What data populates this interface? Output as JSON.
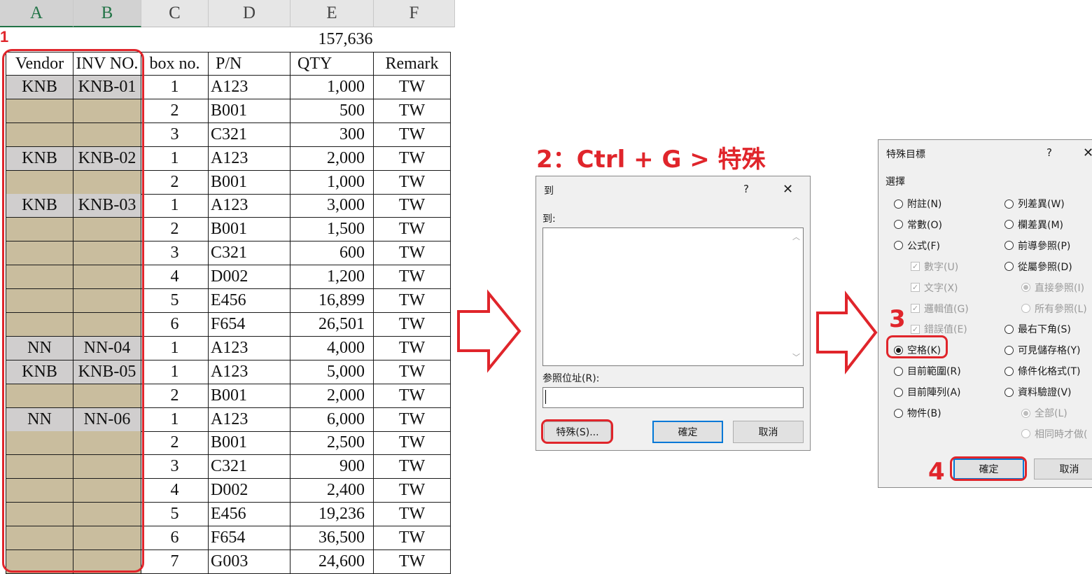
{
  "sheet": {
    "columns": [
      "A",
      "B",
      "C",
      "D",
      "E",
      "F"
    ],
    "row1_marker": "1",
    "total": "157,636",
    "headers": [
      "Vendor",
      "INV NO.",
      "box no.",
      "P/N",
      "QTY",
      "Remark"
    ],
    "rows": [
      {
        "vendor": "KNB",
        "inv": "KNB-01",
        "box": "1",
        "pn": "A123",
        "qty": "1,000",
        "remark": "TW"
      },
      {
        "vendor": "",
        "inv": "",
        "box": "2",
        "pn": "B001",
        "qty": "500",
        "remark": "TW"
      },
      {
        "vendor": "",
        "inv": "",
        "box": "3",
        "pn": "C321",
        "qty": "300",
        "remark": "TW"
      },
      {
        "vendor": "KNB",
        "inv": "KNB-02",
        "box": "1",
        "pn": "A123",
        "qty": "2,000",
        "remark": "TW"
      },
      {
        "vendor": "",
        "inv": "",
        "box": "2",
        "pn": "B001",
        "qty": "1,000",
        "remark": "TW"
      },
      {
        "vendor": "KNB",
        "inv": "KNB-03",
        "box": "1",
        "pn": "A123",
        "qty": "3,000",
        "remark": "TW"
      },
      {
        "vendor": "",
        "inv": "",
        "box": "2",
        "pn": "B001",
        "qty": "1,500",
        "remark": "TW"
      },
      {
        "vendor": "",
        "inv": "",
        "box": "3",
        "pn": "C321",
        "qty": "600",
        "remark": "TW"
      },
      {
        "vendor": "",
        "inv": "",
        "box": "4",
        "pn": "D002",
        "qty": "1,200",
        "remark": "TW"
      },
      {
        "vendor": "",
        "inv": "",
        "box": "5",
        "pn": "E456",
        "qty": "16,899",
        "remark": "TW"
      },
      {
        "vendor": "",
        "inv": "",
        "box": "6",
        "pn": "F654",
        "qty": "26,501",
        "remark": "TW"
      },
      {
        "vendor": "NN",
        "inv": "NN-04",
        "box": "1",
        "pn": "A123",
        "qty": "4,000",
        "remark": "TW"
      },
      {
        "vendor": "KNB",
        "inv": "KNB-05",
        "box": "1",
        "pn": "A123",
        "qty": "5,000",
        "remark": "TW"
      },
      {
        "vendor": "",
        "inv": "",
        "box": "2",
        "pn": "B001",
        "qty": "2,000",
        "remark": "TW"
      },
      {
        "vendor": "NN",
        "inv": "NN-06",
        "box": "1",
        "pn": "A123",
        "qty": "6,000",
        "remark": "TW"
      },
      {
        "vendor": "",
        "inv": "",
        "box": "2",
        "pn": "B001",
        "qty": "2,500",
        "remark": "TW"
      },
      {
        "vendor": "",
        "inv": "",
        "box": "3",
        "pn": "C321",
        "qty": "900",
        "remark": "TW"
      },
      {
        "vendor": "",
        "inv": "",
        "box": "4",
        "pn": "D002",
        "qty": "2,400",
        "remark": "TW"
      },
      {
        "vendor": "",
        "inv": "",
        "box": "5",
        "pn": "E456",
        "qty": "19,236",
        "remark": "TW"
      },
      {
        "vendor": "",
        "inv": "",
        "box": "6",
        "pn": "F654",
        "qty": "36,500",
        "remark": "TW"
      },
      {
        "vendor": "",
        "inv": "",
        "box": "7",
        "pn": "G003",
        "qty": "24,600",
        "remark": "TW"
      }
    ],
    "colors": {
      "filled": "#d0cece",
      "blank": "#c9bd9e",
      "annotation": "#e0252b"
    }
  },
  "step2": {
    "label": "2：Ctrl + G > 特殊"
  },
  "goto_dialog": {
    "title": "到",
    "help": "?",
    "close": "✕",
    "list_label": "到:",
    "ref_label": "参照位址(R):",
    "ref_value": "",
    "special_button": "特殊(S)...",
    "ok_button": "確定",
    "cancel_button": "取消"
  },
  "special_dialog": {
    "title": "特殊目標",
    "help": "?",
    "close": "✕",
    "group_label": "選擇",
    "left_options": [
      {
        "label": "附註(N)",
        "selected": false,
        "disabled": false
      },
      {
        "label": "常數(O)",
        "selected": false,
        "disabled": false
      },
      {
        "label": "公式(F)",
        "selected": false,
        "disabled": false
      },
      {
        "label": "數字(U)",
        "type": "checkbox",
        "disabled": true
      },
      {
        "label": "文字(X)",
        "type": "checkbox",
        "disabled": true
      },
      {
        "label": "邏輯值(G)",
        "type": "checkbox",
        "disabled": true
      },
      {
        "label": "錯誤值(E)",
        "type": "checkbox",
        "disabled": true
      },
      {
        "label": "空格(K)",
        "selected": true,
        "disabled": false
      },
      {
        "label": "目前範圍(R)",
        "selected": false,
        "disabled": false
      },
      {
        "label": "目前陣列(A)",
        "selected": false,
        "disabled": false
      },
      {
        "label": "物件(B)",
        "selected": false,
        "disabled": false
      }
    ],
    "right_options": [
      {
        "label": "列差異(W)",
        "selected": false,
        "disabled": false
      },
      {
        "label": "欄差異(M)",
        "selected": false,
        "disabled": false
      },
      {
        "label": "前導參照(P)",
        "selected": false,
        "disabled": false
      },
      {
        "label": "從屬參照(D)",
        "selected": false,
        "disabled": false
      },
      {
        "label": "直接參照(I)",
        "selected": true,
        "disabled": true
      },
      {
        "label": "所有參照(L)",
        "selected": false,
        "disabled": true
      },
      {
        "label": "最右下角(S)",
        "selected": false,
        "disabled": false
      },
      {
        "label": "可見儲存格(Y)",
        "selected": false,
        "disabled": false
      },
      {
        "label": "條件化格式(T)",
        "selected": false,
        "disabled": false
      },
      {
        "label": "資料驗證(V)",
        "selected": false,
        "disabled": false
      },
      {
        "label": "全部(L)",
        "selected": true,
        "disabled": true
      },
      {
        "label": "相同時才做(",
        "selected": false,
        "disabled": true
      }
    ],
    "ok_button": "確定",
    "cancel_button": "取消"
  },
  "step3": "3",
  "step4": "4"
}
